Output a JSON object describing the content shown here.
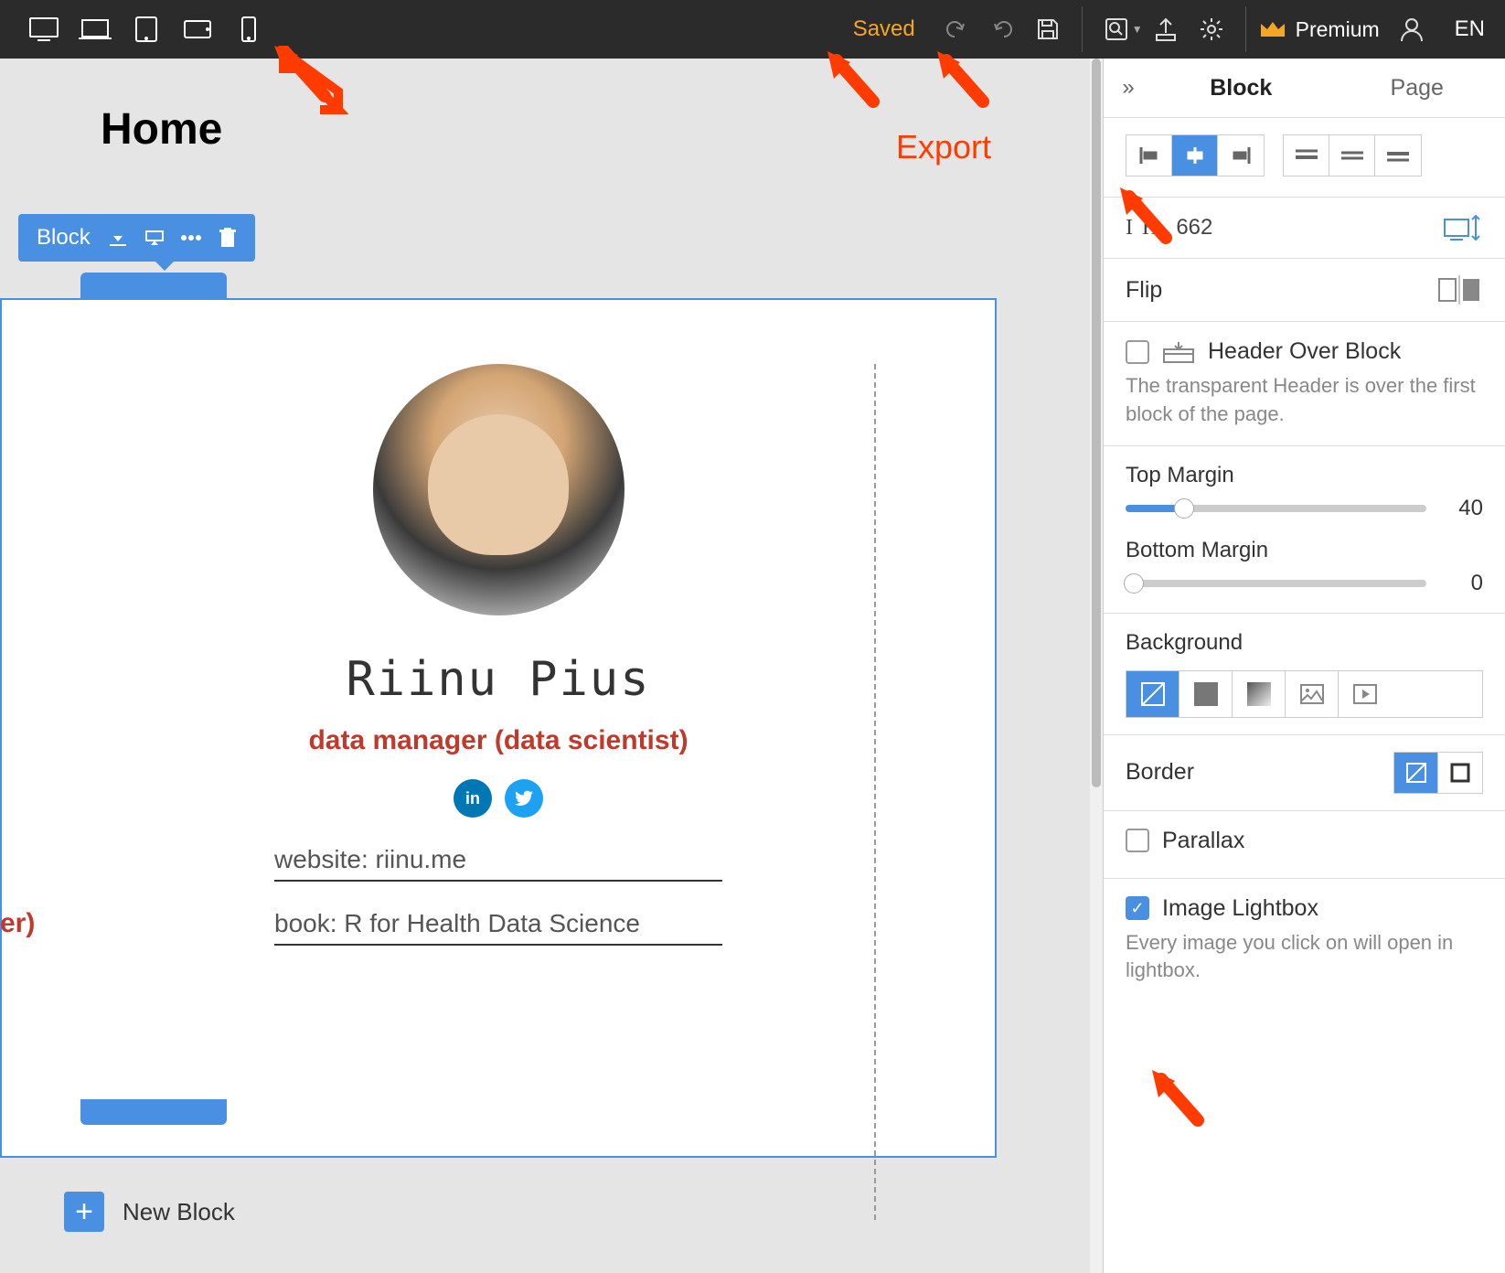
{
  "toolbar": {
    "saved": "Saved",
    "premium": "Premium",
    "lang": "EN"
  },
  "canvas": {
    "page_title": "Home",
    "block_toolbar_label": "Block",
    "name": "Riinu Pius",
    "role": "data manager (data scientist)",
    "link1": "website: riinu.me",
    "link2": "book: R for Health Data Science",
    "edge_text": "er)",
    "new_block": "New Block"
  },
  "annotations": {
    "export_label": "Export"
  },
  "panel": {
    "tabs": {
      "block": "Block",
      "page": "Page"
    },
    "height_label": "I H",
    "height_value": "662",
    "flip_label": "Flip",
    "header_over": {
      "label": "Header Over Block",
      "hint": "The transparent Header is over the first block of the page."
    },
    "top_margin": {
      "label": "Top Margin",
      "value": "40"
    },
    "bottom_margin": {
      "label": "Bottom Margin",
      "value": "0"
    },
    "background_label": "Background",
    "border_label": "Border",
    "parallax_label": "Parallax",
    "lightbox": {
      "label": "Image Lightbox",
      "hint": "Every image you click on will open in lightbox."
    }
  }
}
